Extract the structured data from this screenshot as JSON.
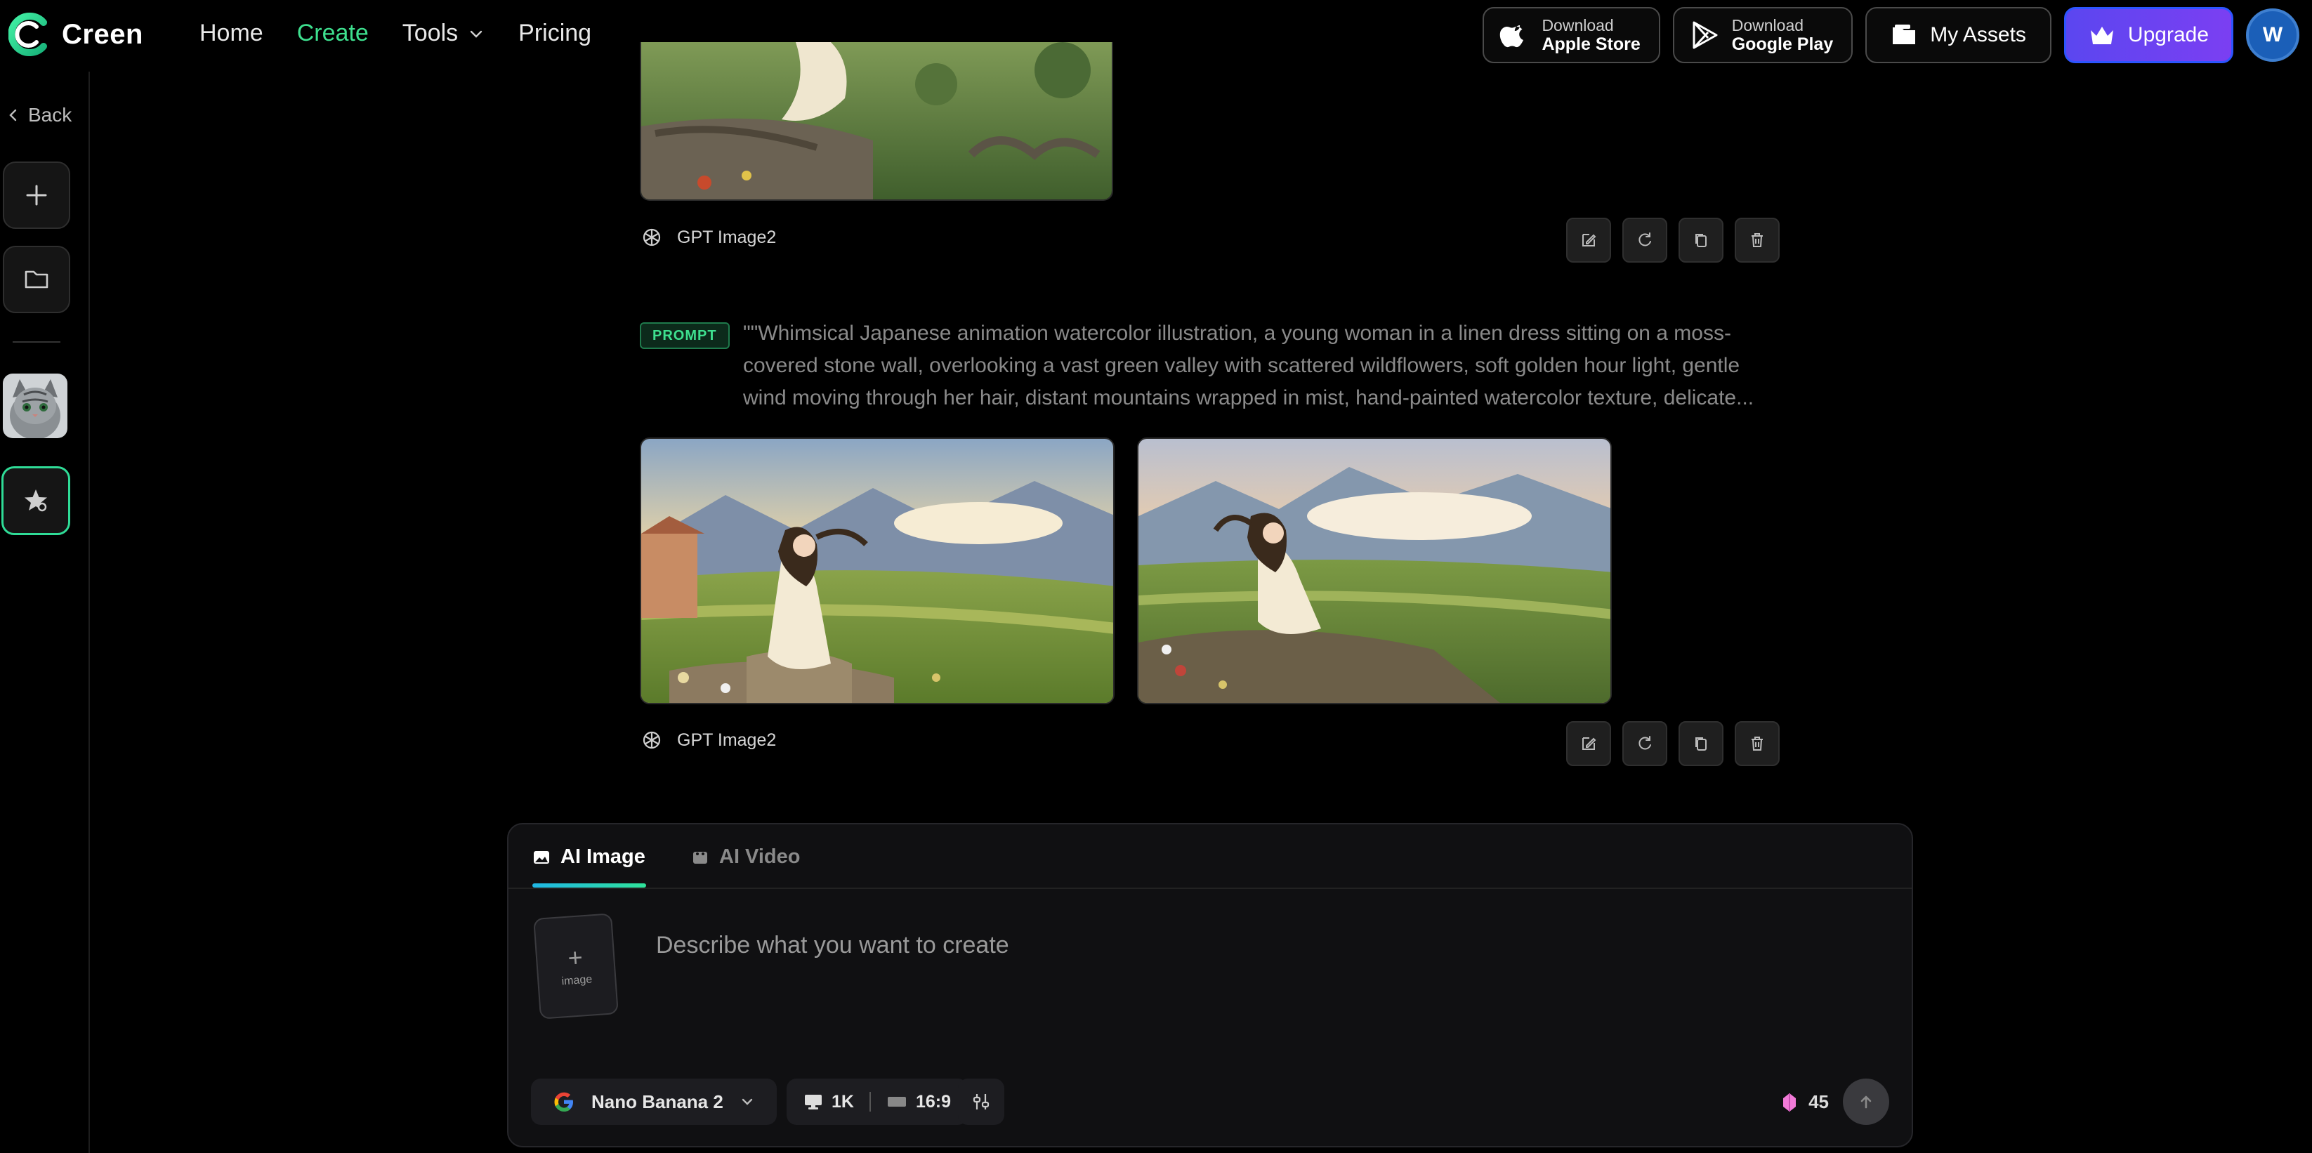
{
  "brand": {
    "name": "Creen"
  },
  "nav": {
    "links": [
      "Home",
      "Create",
      "Tools",
      "Pricing"
    ],
    "apple": {
      "small": "Download",
      "big": "Apple Store"
    },
    "google": {
      "small": "Download",
      "big": "Google Play"
    },
    "assets_label": "My Assets",
    "upgrade_label": "Upgrade",
    "avatar_initial": "W"
  },
  "sidebar": {
    "back_label": "Back"
  },
  "feed": {
    "generations": [
      {
        "model": "GPT Image2"
      },
      {
        "prompt_tag": "PROMPT",
        "prompt": "\"\"Whimsical Japanese animation watercolor illustration, a young woman in a linen dress sitting on a moss-covered stone wall, overlooking a vast green valley with scattered wildflowers, soft golden hour light, gentle wind moving through her hair, distant mountains wrapped in mist, hand-painted watercolor texture, delicate...",
        "model": "GPT Image2"
      }
    ]
  },
  "composer": {
    "tabs": [
      "AI Image",
      "AI Video"
    ],
    "upload_label": "image",
    "placeholder": "Describe what you want to create",
    "model_name": "Nano Banana 2",
    "resolution": "1K",
    "aspect": "16:9",
    "credits": "45"
  },
  "colors": {
    "accent_green": "#3ee08f",
    "upgrade_purple": "#6a44f2"
  },
  "icons": [
    "logo-mark",
    "chevron-down-icon",
    "apple-icon",
    "google-play-icon",
    "folder-icon",
    "crown-icon",
    "chevron-left-icon",
    "plus-icon",
    "star-icon",
    "openai-icon",
    "edit-icon",
    "refresh-icon",
    "copy-icon",
    "trash-icon",
    "image-icon",
    "video-icon",
    "google-icon",
    "monitor-icon",
    "tune-icon",
    "gem-icon",
    "arrow-up-icon"
  ]
}
